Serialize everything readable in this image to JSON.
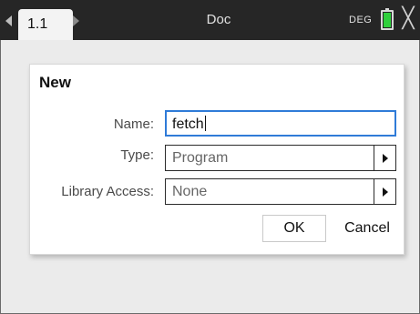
{
  "header": {
    "tab_label": "1.1",
    "doc_title": "Doc",
    "angle_mode": "DEG",
    "battery_icon": "battery-icon",
    "battery_color": "#2fcf3c",
    "close_glyph": "╳"
  },
  "dialog": {
    "title": "New",
    "name_label": "Name:",
    "name_value": "fetch",
    "type_label": "Type:",
    "type_value": "Program",
    "library_label": "Library Access:",
    "library_value": "None",
    "ok_label": "OK",
    "cancel_label": "Cancel",
    "focus_color": "#2f7bd8"
  }
}
